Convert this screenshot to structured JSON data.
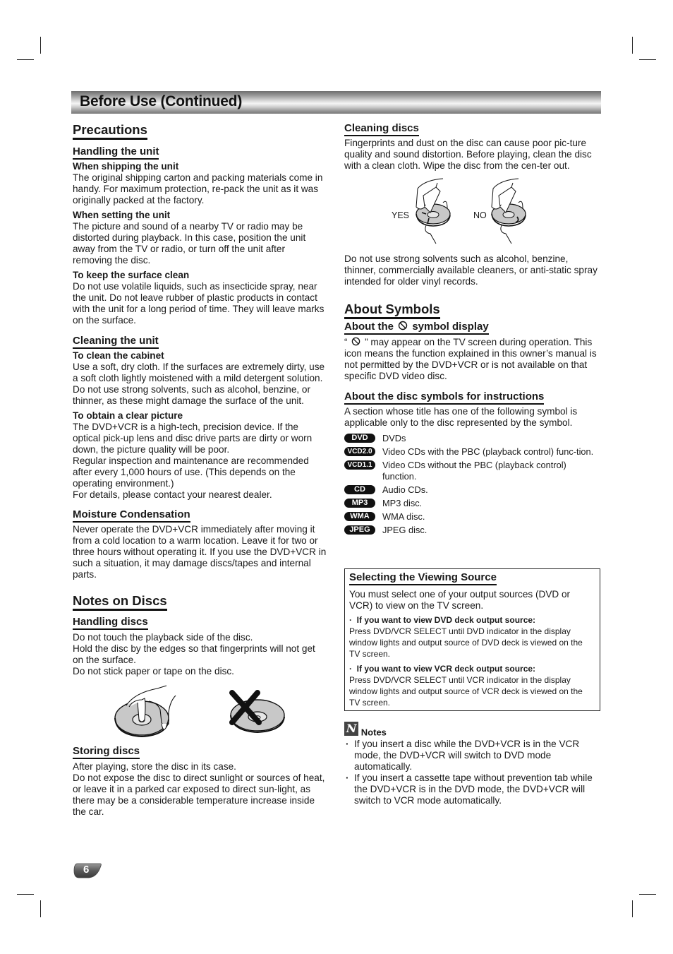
{
  "header": {
    "title": "Before Use (Continued)"
  },
  "left": {
    "precautions": {
      "heading": "Precautions",
      "handling_unit": {
        "heading": "Handling the unit",
        "items": [
          {
            "title": "When shipping the unit",
            "text": "The original shipping carton and packing materials come in handy. For maximum protection, re-pack the unit as it was originally packed at the factory."
          },
          {
            "title": "When setting the unit",
            "text": "The picture and sound of a nearby TV or radio may be distorted during playback. In this case, position the unit away from the TV or radio, or turn off the unit after removing the disc."
          },
          {
            "title": "To keep the surface clean",
            "text": "Do not use volatile liquids, such as insecticide spray, near the unit. Do not leave rubber of plastic products in contact with the unit for a long period of time. They will leave marks on the surface."
          }
        ]
      },
      "cleaning_unit": {
        "heading": "Cleaning the unit",
        "items": [
          {
            "title": "To clean the cabinet",
            "text": "Use a soft, dry cloth. If the surfaces are extremely dirty, use a soft cloth lightly moistened with a mild detergent solution. Do not use strong solvents, such as alcohol, benzine, or thinner, as these might damage the surface of the unit."
          },
          {
            "title": "To obtain a clear picture",
            "text": "The DVD+VCR is a high-tech, precision device. If the optical pick-up lens and disc drive parts are dirty or worn down, the picture quality will be poor.",
            "text2": "Regular inspection and maintenance are recommended after every 1,000 hours of use. (This depends on the operating environment.)",
            "text3": "For details, please contact your nearest dealer."
          }
        ]
      },
      "moisture": {
        "heading": "Moisture Condensation",
        "text": "Never operate the DVD+VCR immediately after moving it from a cold location to a warm location. Leave it for two or three hours without operating it. If you use the DVD+VCR in such a situation, it may damage discs/tapes and internal parts."
      }
    },
    "notes_on_discs": {
      "heading": "Notes on Discs",
      "handling_discs": {
        "heading": "Handling discs",
        "lines": [
          "Do not touch the playback side of the disc.",
          "Hold the disc by the edges so that fingerprints will not get on the surface.",
          "Do not stick paper or tape on the disc."
        ]
      },
      "storing_discs": {
        "heading": "Storing discs",
        "lines": [
          "After playing, store the disc in its case.",
          "Do not expose the disc to direct sunlight or sources of heat, or leave it in a parked car exposed to direct sun-light, as there may be a considerable temperature increase inside the car."
        ]
      }
    }
  },
  "right": {
    "cleaning_discs": {
      "heading": "Cleaning discs",
      "text": "Fingerprints and dust on the disc can cause poor pic-ture quality and sound distortion. Before playing, clean the disc with a clean cloth. Wipe the disc from the cen-ter out.",
      "yes_label": "YES",
      "no_label": "NO",
      "text2": "Do not use strong solvents such as alcohol, benzine, thinner, commercially available cleaners, or anti-static spray intended for older vinyl records."
    },
    "about_symbols": {
      "heading": "About Symbols",
      "symbol_display": {
        "heading_pre": "About the",
        "heading_post": "symbol display",
        "text_open": "“",
        "text": "” may appear on the TV screen during operation. This icon means the function explained in this owner’s manual is not permitted by the DVD+VCR or is not available on that specific DVD video disc."
      },
      "disc_symbols": {
        "heading": "About the disc symbols for instructions",
        "intro": "A section whose title has one of the following symbol is applicable only to the disc represented by the symbol.",
        "items": [
          {
            "badge": "DVD",
            "desc": "DVDs"
          },
          {
            "badge": "VCD2.0",
            "desc": "Video CDs with the PBC (playback control) func-tion."
          },
          {
            "badge": "VCD1.1",
            "desc": "Video CDs without the PBC (playback control) function."
          },
          {
            "badge": "CD",
            "desc": "Audio CDs."
          },
          {
            "badge": "MP3",
            "desc": "MP3 disc."
          },
          {
            "badge": "WMA",
            "desc": "WMA disc."
          },
          {
            "badge": "JPEG",
            "desc": "JPEG disc."
          }
        ]
      }
    },
    "viewing_source": {
      "heading": "Selecting the Viewing Source",
      "intro": "You must select one of your output sources (DVD or VCR) to view on the TV screen.",
      "items": [
        {
          "title": "If you want to view DVD deck output source:",
          "text": "Press DVD/VCR SELECT until DVD indicator in the display window lights and output source of DVD deck is viewed on the TV screen."
        },
        {
          "title": "If you want to view VCR deck output source:",
          "text": "Press DVD/VCR SELECT until VCR indicator in the display window lights and output source of VCR deck is viewed on the TV screen."
        }
      ]
    },
    "notes": {
      "icon_letter": "N",
      "heading": "Notes",
      "items": [
        "If you insert a disc while the DVD+VCR is in the VCR mode, the DVD+VCR will switch to DVD mode automatically.",
        "If you insert a cassette tape without prevention tab while the DVD+VCR is in the DVD mode, the DVD+VCR will switch to VCR mode automatically."
      ]
    }
  },
  "footer": {
    "page_number": "6"
  }
}
